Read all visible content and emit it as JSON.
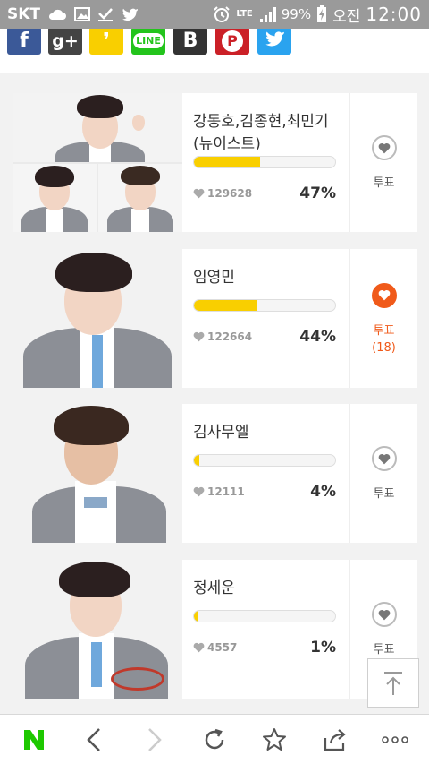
{
  "status_bar": {
    "carrier": "SKT",
    "network": "LTE",
    "battery": "99%",
    "ampm": "오전",
    "time": "12:00"
  },
  "share_row": {
    "buttons": [
      {
        "name": "facebook",
        "glyph": "f",
        "color": "#3b5998"
      },
      {
        "name": "google-plus",
        "glyph": "g+",
        "color": "#444444"
      },
      {
        "name": "kakaostory",
        "glyph": "❜",
        "color": "#f9cf00"
      },
      {
        "name": "line",
        "glyph": "LINE",
        "color": "#23c41c"
      },
      {
        "name": "band",
        "glyph": "B",
        "color": "#333333"
      },
      {
        "name": "pinterest",
        "glyph": "P",
        "color": "#cb2027"
      },
      {
        "name": "twitter",
        "glyph": "t",
        "color": "#2aa3ef"
      }
    ]
  },
  "accent_color": "#f05a1a",
  "bar_color": "#f9cf00",
  "candidates": [
    {
      "name": "강동호,김종현,최민기 (뉴이스트)",
      "votes": "129628",
      "percent": "47%",
      "fill": 0.47,
      "vote_label": "투표",
      "voted": false,
      "vote_count": ""
    },
    {
      "name": "임영민",
      "votes": "122664",
      "percent": "44%",
      "fill": 0.44,
      "vote_label": "투표",
      "voted": true,
      "vote_count": "(18)"
    },
    {
      "name": "김사무엘",
      "votes": "12111",
      "percent": "4%",
      "fill": 0.04,
      "vote_label": "투표",
      "voted": false,
      "vote_count": ""
    },
    {
      "name": "정세운",
      "votes": "4557",
      "percent": "1%",
      "fill": 0.01,
      "vote_label": "투표",
      "voted": false,
      "vote_count": ""
    }
  ],
  "bottom_bar": {
    "items": [
      "naver-home-icon",
      "back-icon",
      "forward-icon",
      "refresh-icon",
      "bookmark-star-icon",
      "share-icon",
      "more-icon"
    ]
  }
}
